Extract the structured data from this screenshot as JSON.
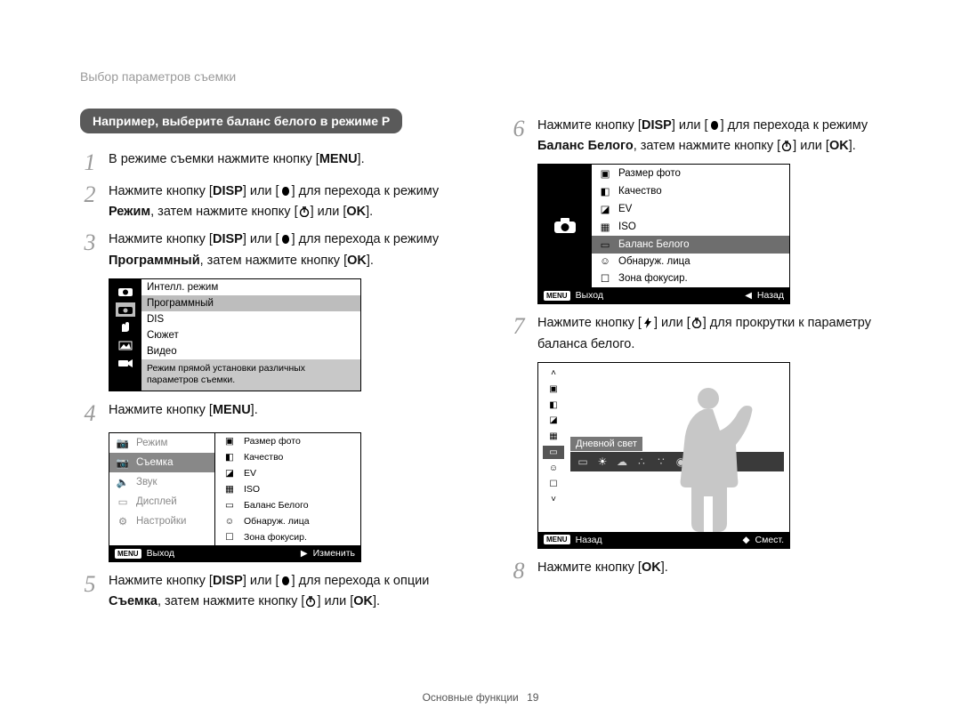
{
  "breadcrumb": "Выбор параметров съемки",
  "example_banner": "Например, выберите баланс белого в режиме P",
  "keys": {
    "menu": "MENU",
    "disp": "DISP",
    "ok": "OK"
  },
  "steps_left": [
    {
      "n": "1",
      "text_a": "В режиме съемки нажмите кнопку [",
      "text_b": "]."
    },
    {
      "n": "2",
      "text_a": "Нажмите кнопку [",
      "text_b": "] или [",
      "text_c": "] для перехода к режиму ",
      "bold": "Режим",
      "text_d": ", затем нажмите кнопку [",
      "text_e": "] или [",
      "text_f": "]."
    },
    {
      "n": "3",
      "text_a": "Нажмите кнопку [",
      "text_b": "] или [",
      "text_c": "] для перехода к режиму ",
      "bold": "Программный",
      "text_d": ", затем нажмите кнопку [",
      "text_e": "]."
    },
    {
      "n": "4",
      "text_a": "Нажмите кнопку [",
      "text_b": "]."
    },
    {
      "n": "5",
      "text_a": "Нажмите кнопку [",
      "text_b": "] или [",
      "text_c": "] для перехода к опции ",
      "bold": "Съемка",
      "text_d": ", затем нажмите кнопку [",
      "text_e": "] или [",
      "text_f": "]."
    }
  ],
  "steps_right": [
    {
      "n": "6",
      "text_a": "Нажмите кнопку [",
      "text_b": "] или [",
      "text_c": "] для перехода к режиму ",
      "bold": "Баланс Белого",
      "text_d": ", затем нажмите кнопку [",
      "text_e": "] или [",
      "text_f": "]."
    },
    {
      "n": "7",
      "text_a": "Нажмите кнопку [",
      "text_b": "] или [",
      "text_c": "] для прокрутки к параметру баланса белого."
    },
    {
      "n": "8",
      "text_a": "Нажмите кнопку [",
      "text_b": "]."
    }
  ],
  "screen1": {
    "items": [
      {
        "icon": "smart",
        "label": "Интелл. режим"
      },
      {
        "icon": "camera",
        "label": "Программный",
        "selected": true
      },
      {
        "icon": "hand",
        "label": "DIS"
      },
      {
        "icon": "scene",
        "label": "Сюжет"
      },
      {
        "icon": "video",
        "label": "Видео"
      }
    ],
    "desc": "Режим прямой установки различных параметров съемки."
  },
  "screen2": {
    "left": [
      {
        "icon": "camera-mode",
        "label": "Режим"
      },
      {
        "icon": "camera",
        "label": "Съемка",
        "selected": true
      },
      {
        "icon": "sound",
        "label": "Звук"
      },
      {
        "icon": "display",
        "label": "Дисплей"
      },
      {
        "icon": "gear",
        "label": "Настройки"
      }
    ],
    "right": [
      {
        "icon": "size",
        "label": "Размер фото"
      },
      {
        "icon": "quality",
        "label": "Качество"
      },
      {
        "icon": "ev",
        "label": "EV"
      },
      {
        "icon": "iso",
        "label": "ISO"
      },
      {
        "icon": "wb",
        "label": "Баланс Белого"
      },
      {
        "icon": "face",
        "label": "Обнаруж. лица"
      },
      {
        "icon": "focus",
        "label": "Зона фокусир."
      }
    ],
    "foot_left": "Выход",
    "foot_right": "Изменить"
  },
  "screen3": {
    "items": [
      {
        "icon": "size",
        "label": "Размер фото"
      },
      {
        "icon": "quality",
        "label": "Качество"
      },
      {
        "icon": "ev",
        "label": "EV"
      },
      {
        "icon": "iso",
        "label": "ISO"
      },
      {
        "icon": "wb",
        "label": "Баланс Белого",
        "selected": true
      },
      {
        "icon": "face",
        "label": "Обнаруж. лица"
      },
      {
        "icon": "focus",
        "label": "Зона фокусир."
      }
    ],
    "foot_left": "Выход",
    "foot_right": "Назад"
  },
  "screen4": {
    "label": "Дневной свет",
    "foot_left": "Назад",
    "foot_right": "Смест."
  },
  "footer": {
    "section": "Основные функции",
    "page": "19"
  }
}
